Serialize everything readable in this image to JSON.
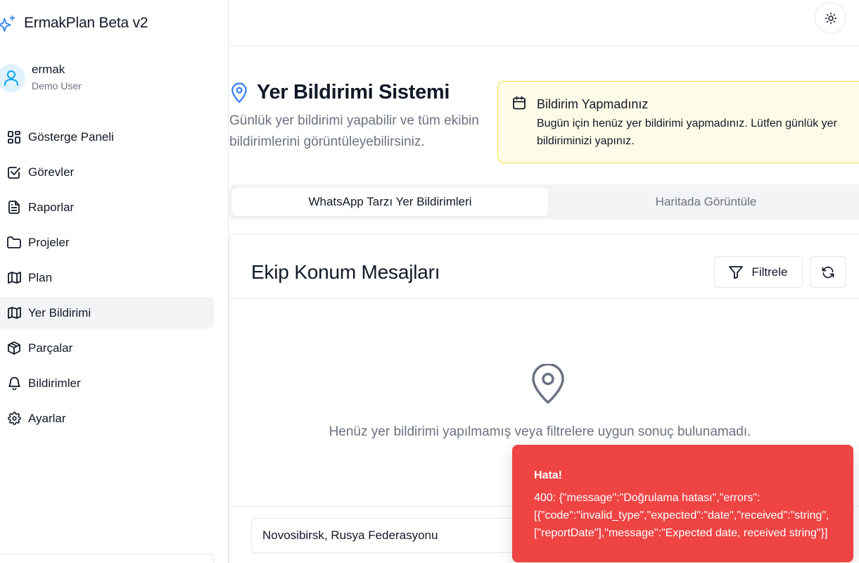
{
  "app": {
    "title": "ErmakPlan Beta v2"
  },
  "user": {
    "name": "ermak",
    "role": "Demo User"
  },
  "sidebar": {
    "items": [
      {
        "label": "Gösterge Paneli",
        "icon": "dashboard-icon"
      },
      {
        "label": "Görevler",
        "icon": "checkbox-icon"
      },
      {
        "label": "Raporlar",
        "icon": "file-text-icon"
      },
      {
        "label": "Projeler",
        "icon": "folder-icon"
      },
      {
        "label": "Plan",
        "icon": "map-icon"
      },
      {
        "label": "Yer Bildirimi",
        "icon": "map-icon",
        "active": true
      },
      {
        "label": "Parçalar",
        "icon": "package-icon"
      },
      {
        "label": "Bildirimler",
        "icon": "bell-icon"
      },
      {
        "label": "Ayarlar",
        "icon": "gear-icon"
      }
    ]
  },
  "page": {
    "title": "Yer Bildirimi Sistemi",
    "description": "Günlük yer bildirimi yapabilir ve tüm ekibin bildirimlerini görüntüleyebilirsiniz."
  },
  "alert": {
    "title": "Bildirim Yapmadınız",
    "body": "Bugün için henüz yer bildirimi yapmadınız. Lütfen günlük yer bildiriminizi yapınız."
  },
  "tabs": [
    {
      "label": "WhatsApp Tarzı Yer Bildirimleri",
      "active": true
    },
    {
      "label": "Haritada Görüntüle",
      "active": false
    }
  ],
  "card": {
    "title": "Ekip Konum Mesajları",
    "filter_label": "Filtrele",
    "empty_text": "Henüz yer bildirimi yapılmamış veya filtrelere uygun sonuç bulunamadı.",
    "location_value": "Novosibirsk, Rusya Federasyonu"
  },
  "toast": {
    "title": "Hata!",
    "body": "400: {\"message\":\"Doğrulama hatası\",\"errors\":\n[{\"code\":\"invalid_type\",\"expected\":\"date\",\"received\":\"string\",\n[\"reportDate\"],\"message\":\"Expected date, received string\"}]"
  },
  "colors": {
    "accent": "#3b82f6",
    "alert_bg": "#fefce8",
    "alert_border": "#fde047",
    "toast_bg": "#ef4444"
  }
}
